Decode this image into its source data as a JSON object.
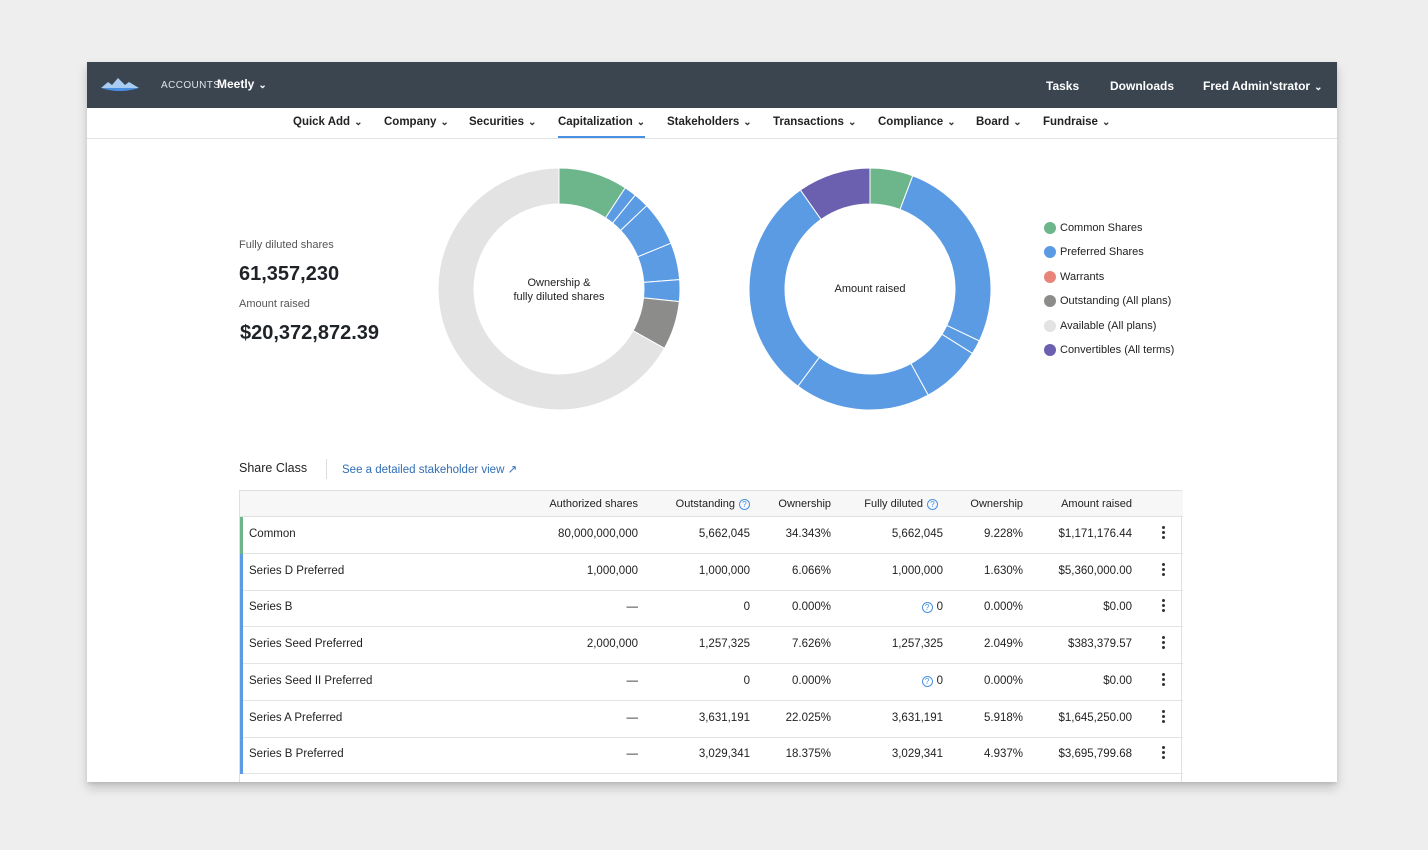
{
  "topbar": {
    "accounts_label": "ACCOUNTS",
    "company_name": "Meetly",
    "tasks": "Tasks",
    "downloads": "Downloads",
    "user": "Fred Admin'strator"
  },
  "nav": {
    "items": [
      "Quick Add",
      "Company",
      "Securities",
      "Capitalization",
      "Stakeholders",
      "Transactions",
      "Compliance",
      "Board",
      "Fundraise"
    ],
    "active": "Capitalization"
  },
  "stats": {
    "fully_diluted_label": "Fully diluted shares",
    "fully_diluted_value": "61,357,230",
    "amount_raised_label": "Amount raised",
    "amount_raised_value": "$20,372,872.39"
  },
  "colors": {
    "common": "#6db58a",
    "preferred": "#5a9be3",
    "warrants": "#e8857a",
    "outstanding": "#8c8c8a",
    "available": "#e3e3e3",
    "convertibles": "#6b5fb0",
    "accent": "#4a90e2",
    "topbar": "#3b4550"
  },
  "chart_data": [
    {
      "type": "pie",
      "center_label": [
        "Ownership &",
        "fully diluted shares"
      ],
      "slices": [
        {
          "category": "common",
          "value": 9.228
        },
        {
          "category": "preferred",
          "value": 1.63
        },
        {
          "category": "preferred",
          "value": 2.049
        },
        {
          "category": "preferred",
          "value": 5.918
        },
        {
          "category": "preferred",
          "value": 4.937
        },
        {
          "category": "preferred",
          "value": 2.9
        },
        {
          "category": "outstanding",
          "value": 6.5
        },
        {
          "category": "available",
          "value": 66.838
        }
      ]
    },
    {
      "type": "pie",
      "center_label": [
        "Amount raised"
      ],
      "slices": [
        {
          "category": "common",
          "value": 1171176.44
        },
        {
          "category": "preferred",
          "value": 5360000.0
        },
        {
          "category": "preferred",
          "value": 0
        },
        {
          "category": "preferred",
          "value": 383379.57
        },
        {
          "category": "preferred",
          "value": 0
        },
        {
          "category": "preferred",
          "value": 1645250.0
        },
        {
          "category": "preferred",
          "value": 3695799.68
        },
        {
          "category": "preferred",
          "value": 6130000.0
        },
        {
          "category": "convertibles",
          "value": 1987266.7
        }
      ]
    }
  ],
  "legend": [
    {
      "label": "Common Shares",
      "color": "#6db58a"
    },
    {
      "label": "Preferred Shares",
      "color": "#5a9be3"
    },
    {
      "label": "Warrants",
      "color": "#e8857a"
    },
    {
      "label": "Outstanding (All plans)",
      "color": "#8c8c8a"
    },
    {
      "label": "Available (All plans)",
      "color": "#e3e3e3"
    },
    {
      "label": "Convertibles (All terms)",
      "color": "#6b5fb0"
    }
  ],
  "share_class": {
    "title": "Share Class",
    "link": "See a detailed stakeholder view ↗",
    "columns": [
      "Authorized shares",
      "Outstanding",
      "Ownership",
      "Fully diluted",
      "Ownership",
      "Amount raised"
    ],
    "rows": [
      {
        "name": "Common",
        "type": "common",
        "authorized": "80,000,000,000",
        "outstanding": "5,662,045",
        "ownership": "34.343%",
        "fully_diluted": "5,662,045",
        "fd_help": false,
        "fd_ownership": "9.228%",
        "amount": "$1,171,176.44"
      },
      {
        "name": "Series D Preferred",
        "type": "preferred",
        "authorized": "1,000,000",
        "outstanding": "1,000,000",
        "ownership": "6.066%",
        "fully_diluted": "1,000,000",
        "fd_help": false,
        "fd_ownership": "1.630%",
        "amount": "$5,360,000.00"
      },
      {
        "name": "Series B",
        "type": "preferred",
        "authorized": "—",
        "outstanding": "0",
        "ownership": "0.000%",
        "fully_diluted": "0",
        "fd_help": true,
        "fd_ownership": "0.000%",
        "amount": "$0.00"
      },
      {
        "name": "Series Seed Preferred",
        "type": "preferred",
        "authorized": "2,000,000",
        "outstanding": "1,257,325",
        "ownership": "7.626%",
        "fully_diluted": "1,257,325",
        "fd_help": false,
        "fd_ownership": "2.049%",
        "amount": "$383,379.57"
      },
      {
        "name": "Series Seed II Preferred",
        "type": "preferred",
        "authorized": "—",
        "outstanding": "0",
        "ownership": "0.000%",
        "fully_diluted": "0",
        "fd_help": true,
        "fd_ownership": "0.000%",
        "amount": "$0.00"
      },
      {
        "name": "Series A Preferred",
        "type": "preferred",
        "authorized": "—",
        "outstanding": "3,631,191",
        "ownership": "22.025%",
        "fully_diluted": "3,631,191",
        "fd_help": false,
        "fd_ownership": "5.918%",
        "amount": "$1,645,250.00"
      },
      {
        "name": "Series B Preferred",
        "type": "preferred",
        "authorized": "—",
        "outstanding": "3,029,341",
        "ownership": "18.375%",
        "fully_diluted": "3,029,341",
        "fd_help": false,
        "fd_ownership": "4.937%",
        "amount": "$3,695,799.68"
      }
    ]
  }
}
